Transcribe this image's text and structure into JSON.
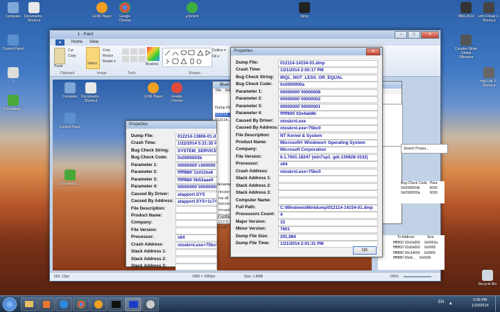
{
  "desktop_icons_left": [
    {
      "label": "Computer",
      "color": "#7fa7d8"
    },
    {
      "label": "Documents - Shortcut",
      "color": "#e8e8e8"
    },
    {
      "label": "Control Panel",
      "color": "#5a8fd0"
    },
    {
      "label": "1",
      "color": "#ddd"
    },
    {
      "label": "[Orchestra]...",
      "color": "#4aa83a"
    }
  ],
  "desktop_icons_top": [
    {
      "label": "GOM Player",
      "color": "#f0a020"
    },
    {
      "label": "Google Chrome",
      "color": "#e24b3b"
    },
    {
      "label": "µTorrent",
      "color": "#3fae3f"
    },
    {
      "label": "xbmc",
      "color": "#222"
    }
  ],
  "desktop_icons_right": [
    {
      "label": "NBA 2K14",
      "color": "#333"
    },
    {
      "label": "Left 4 Dead 2 - Shortcut",
      "color": "#444"
    },
    {
      "label": "Counter-Strike Global Offensive",
      "color": "#555"
    },
    {
      "label": "Half-Life 2 - Shortcut",
      "color": "#666"
    },
    {
      "label": "Recycle Bin",
      "color": "#cfd8e0"
    }
  ],
  "paint": {
    "title": "1 - Paint",
    "tabs": [
      "Home",
      "View"
    ],
    "file_tab": "▾",
    "groups": [
      "Clipboard",
      "Image",
      "Tools",
      "Shapes"
    ],
    "clipboard": {
      "paste": "Paste",
      "cut": "Cut",
      "copy": "Copy"
    },
    "image": {
      "select": "Select",
      "crop": "Crop",
      "resize": "Resize",
      "rotate": "Rotate ▾"
    },
    "brushes": "Brushes",
    "outline": "Outline ▾",
    "fill": "Fill ▾",
    "status": {
      "coords": "602, 13px",
      "size": "1680 × 1050px",
      "filesize": "Size: 1.8MB",
      "zoom": "100%"
    }
  },
  "props_small": {
    "title": "Properties",
    "rows": [
      {
        "label": "Dump File:",
        "value": "012214-13806-01.d"
      },
      {
        "label": "Crash Time:",
        "value": "1/22/2014 5:21:35 PM"
      },
      {
        "label": "Bug Check String:",
        "value": "SYSTEM_SERVICE_"
      },
      {
        "label": "Bug Check Code:",
        "value": "0x0000003b"
      },
      {
        "label": "Parameter 1:",
        "value": "00000000`c000000"
      },
      {
        "label": "Parameter 2:",
        "value": "fffff880`11d11ba6"
      },
      {
        "label": "Parameter 3:",
        "value": "fffff880`0b52aae0"
      },
      {
        "label": "Parameter 4:",
        "value": "00000000`00000000"
      },
      {
        "label": "Caused By Driver:",
        "value": "atapport.SYS"
      },
      {
        "label": "Caused By Address:",
        "value": "atapport.SYS+1c74"
      },
      {
        "label": "File Description:",
        "value": ""
      },
      {
        "label": "Product Name:",
        "value": ""
      },
      {
        "label": "Company:",
        "value": ""
      },
      {
        "label": "File Version:",
        "value": ""
      },
      {
        "label": "Processor:",
        "value": "x64"
      },
      {
        "label": "Crash Address:",
        "value": "ntoskrnl.exe+75bc0"
      },
      {
        "label": "Stack Address 1:",
        "value": ""
      },
      {
        "label": "Stack Address 2:",
        "value": ""
      },
      {
        "label": "Stack Address 3:",
        "value": ""
      }
    ]
  },
  "props_main": {
    "title": "Properties",
    "ok": "OK",
    "rows": [
      {
        "label": "Dump File:",
        "value": "012114-14154-01.dmp"
      },
      {
        "label": "Crash Time:",
        "value": "1/21/2014 2:00:17 PM"
      },
      {
        "label": "Bug Check String:",
        "value": "IRQL_NOT_LESS_OR_EQUAL"
      },
      {
        "label": "Bug Check Code:",
        "value": "0x0000000a"
      },
      {
        "label": "Parameter 1:",
        "value": "00000000`00000008"
      },
      {
        "label": "Parameter 2:",
        "value": "00000000`00000002"
      },
      {
        "label": "Parameter 3:",
        "value": "00000000`00000001"
      },
      {
        "label": "Parameter 4:",
        "value": "fffff800`02e4ab8b"
      },
      {
        "label": "Caused By Driver:",
        "value": "ntoskrnl.exe"
      },
      {
        "label": "Caused By Address:",
        "value": "ntoskrnl.exe+75bc0"
      },
      {
        "label": "File Description:",
        "value": "NT Kernel & System"
      },
      {
        "label": "Product Name:",
        "value": "Microsoft® Windows® Operating System"
      },
      {
        "label": "Company:",
        "value": "Microsoft Corporation"
      },
      {
        "label": "File Version:",
        "value": "6.1.7601.18247 (win7sp1_gdr.130828-1532)"
      },
      {
        "label": "Processor:",
        "value": "x64"
      },
      {
        "label": "Crash Address:",
        "value": "ntoskrnl.exe+75bc0"
      },
      {
        "label": "Stack Address 1:",
        "value": ""
      },
      {
        "label": "Stack Address 2:",
        "value": ""
      },
      {
        "label": "Stack Address 3:",
        "value": ""
      },
      {
        "label": "Computer Name:",
        "value": ""
      },
      {
        "label": "Full Path:",
        "value": "C:\\Windows\\Minidump\\012114-14154-01.dmp"
      },
      {
        "label": "Processors Count:",
        "value": "4"
      },
      {
        "label": "Major Version:",
        "value": "15"
      },
      {
        "label": "Minor Version:",
        "value": "7601"
      },
      {
        "label": "Dump File Size:",
        "value": "291,984"
      },
      {
        "label": "Dump File Time:",
        "value": "1/21/2014 2:01:31 PM"
      }
    ]
  },
  "bsv": {
    "title": "BlueScr...",
    "menu": [
      "File",
      "Edit"
    ],
    "col1": "Dump File",
    "files": [
      "012214...",
      "012114..."
    ],
    "col_filename": "Filename",
    "drivers": [
      "ntoskrnl...",
      "hal.dll",
      "kdcom.dll",
      "mcupdate...",
      "PSHED...",
      "CLFS.SYS",
      "CI.dll"
    ],
    "status": "2 Crashes, 1 S...",
    "right_cols": [
      "Bug Check Code",
      "Para"
    ],
    "right_rows": [
      [
        "0x0000003b",
        "0000"
      ],
      [
        "0x0000000a",
        "0000"
      ]
    ],
    "search": "Search Progra...",
    "addr_cols": [
      "To Address",
      "Size"
    ],
    "addr_rows": [
      [
        "fffff800`02e2a000",
        "0x0002a"
      ],
      [
        "fffff800`02a5b000",
        "0x0005"
      ],
      [
        "fffff880`00c34000",
        "0x0000"
      ],
      [
        "fffff880`00e8...",
        "0x0000"
      ]
    ],
    "sys_text": "com.dll"
  },
  "taskbar": {
    "clock_time": "2:06 PM",
    "clock_date": "1/23/2014",
    "lang": "EN"
  }
}
